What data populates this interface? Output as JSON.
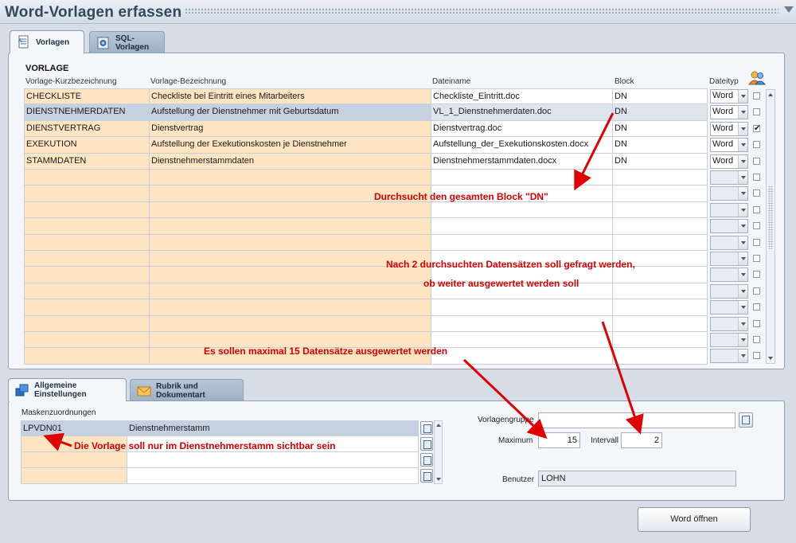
{
  "window": {
    "title": "Word-Vorlagen erfassen"
  },
  "top_tabs": [
    {
      "label": "Vorlagen",
      "active": true
    },
    {
      "label": "SQL-Vorlagen",
      "active": false
    }
  ],
  "vorlage": {
    "section_title": "VORLAGE",
    "columns": [
      "Vorlage-Kurzbezeichnung",
      "Vorlage-Bezeichnung",
      "Dateiname",
      "Block",
      "Dateityp"
    ],
    "rows": [
      {
        "kurz": "CHECKLISTE",
        "bez": "Checkliste bei Eintritt eines Mitarbeiters",
        "datei": "Checkliste_Eintritt.doc",
        "block": "DN",
        "typ": "Word",
        "checked": false
      },
      {
        "kurz": "DIENSTNEHMERDATEN",
        "bez": "Aufstellung der Dienstnehmer mit Geburtsdatum",
        "datei": "VL_1_Dienstnehmerdaten.doc",
        "block": "DN",
        "typ": "Word",
        "checked": false
      },
      {
        "kurz": "DIENSTVERTRAG",
        "bez": "Dienstvertrag",
        "datei": "Dienstvertrag.doc",
        "block": "DN",
        "typ": "Word",
        "checked": true
      },
      {
        "kurz": "EXEKUTION",
        "bez": "Aufstellung der Exekutionskosten je Dienstnehmer",
        "datei": "Aufstellung_der_Exekutionskosten.docx",
        "block": "DN",
        "typ": "Word",
        "checked": false
      },
      {
        "kurz": "STAMMDATEN",
        "bez": "Dienstnehmerstammdaten",
        "datei": "Dienstnehmerstammdaten.docx",
        "block": "DN",
        "typ": "Word",
        "checked": false
      }
    ],
    "empty_rows": 12,
    "selected_row": 1
  },
  "annotations": {
    "block": "Durchsucht den gesamten Block \"DN\"",
    "interval_1": "Nach 2 durchsuchten Datensätzen soll gefragt werden,",
    "interval_2": "ob weiter ausgewertet werden soll",
    "maximum": "Es sollen maximal 15 Datensätze ausgewertet werden",
    "mask": "Die Vorlage soll nur im Dienstnehmerstamm sichtbar sein",
    "color": "#d90000"
  },
  "bottom_tabs": [
    {
      "label": "Allgemeine Einstellungen",
      "active": true
    },
    {
      "label": "Rubrik und Dokumentart",
      "active": false
    }
  ],
  "masken": {
    "label": "Maskenzuordnungen",
    "rows": [
      {
        "code": "LPVDN01",
        "name": "Dienstnehmerstamm"
      },
      {
        "code": "",
        "name": ""
      },
      {
        "code": "",
        "name": ""
      },
      {
        "code": "",
        "name": ""
      }
    ]
  },
  "settings": {
    "vorlagengruppe_label": "Vorlagengruppe",
    "vorlagengruppe_value": "",
    "maximum_label": "Maximum",
    "maximum_value": "15",
    "intervall_label": "Intervall",
    "intervall_value": "2",
    "benutzer_label": "Benutzer",
    "benutzer_value": "LOHN"
  },
  "buttons": {
    "word_oeffnen": "Word öffnen"
  }
}
